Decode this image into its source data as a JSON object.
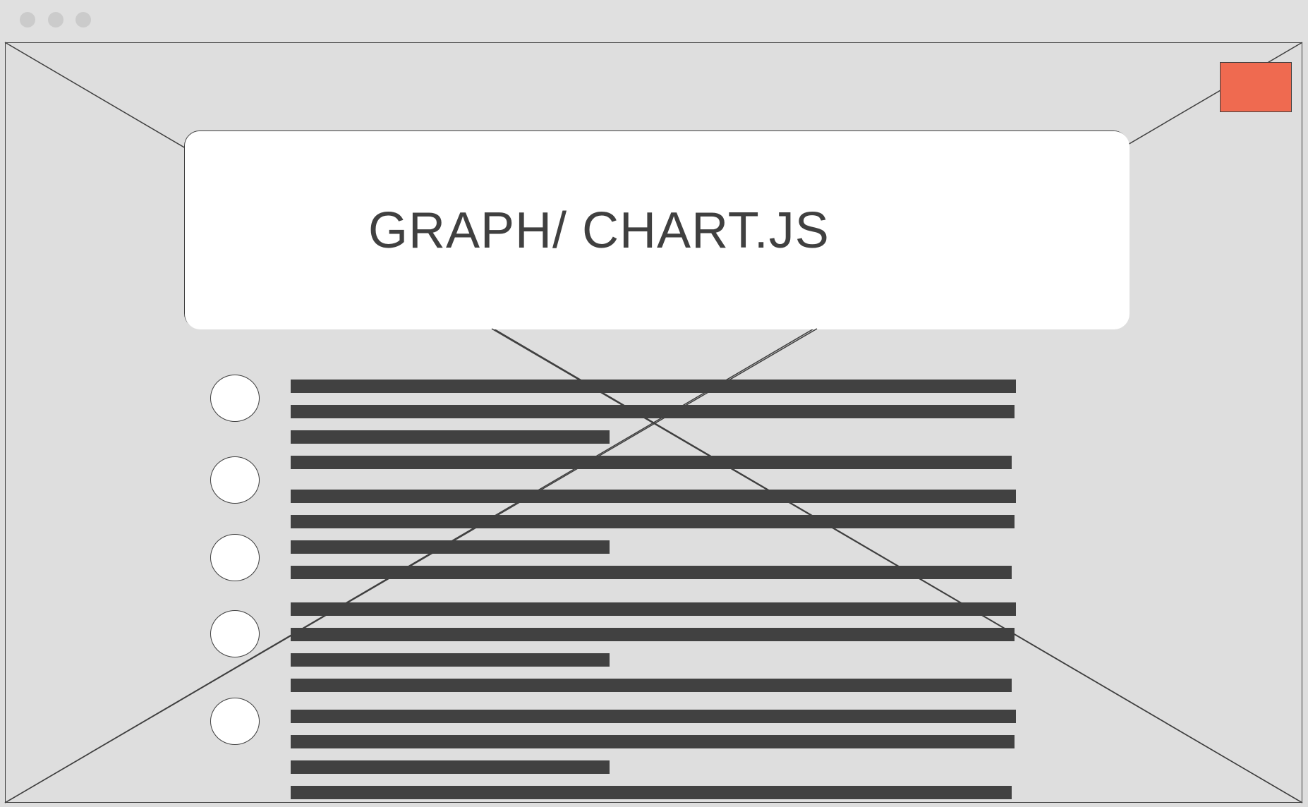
{
  "window": {
    "controls": [
      "window-dot",
      "window-dot",
      "window-dot"
    ]
  },
  "close_button": {
    "color": "#ef6a50"
  },
  "card": {
    "title": "GRAPH/ CHART.JS"
  },
  "list": {
    "item_count": 5,
    "line_color": "#414141"
  },
  "colors": {
    "background": "#dedede",
    "stroke": "#3f3f3f",
    "accent": "#ef6a50"
  }
}
